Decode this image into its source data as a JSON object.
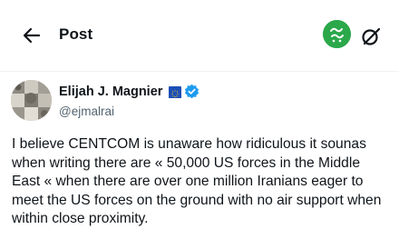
{
  "header": {
    "title": "Post",
    "back_icon": "arrow-left-icon",
    "channel_logo_icon": "channel-logo",
    "channel_logo_color": "#2aa84a",
    "grok_icon": "grok-icon"
  },
  "author": {
    "name": "Elijah J. Magnier",
    "flag_icon": "eu-flag-icon",
    "verified_icon": "verified-badge-icon",
    "verified_color": "#1d9bf0",
    "handle": "@ejmalrai"
  },
  "post": {
    "text": "I believe CENTCOM is unaware how ridiculous it sounas\nwhen writing there are « 50,000 US forces in the Middle\nEast «  when there are over one million Iranians eager to\nmeet the US forces on the ground with no air support when\nwithin close proximity."
  }
}
